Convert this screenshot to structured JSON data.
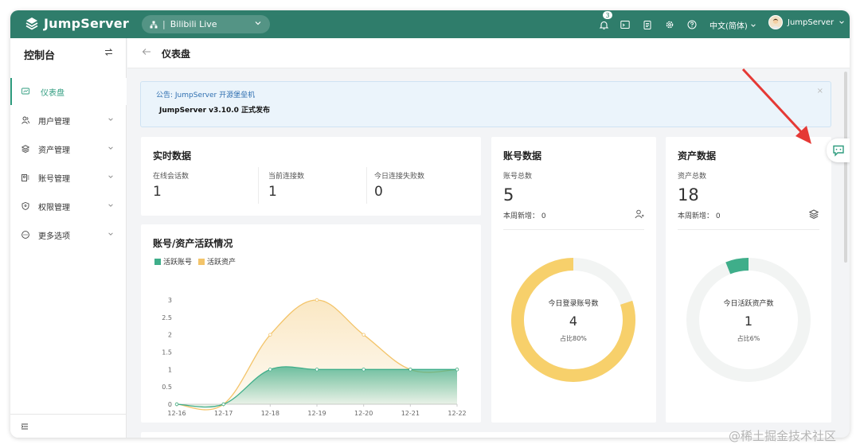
{
  "header": {
    "logo_text": "JumpServer",
    "org_name": "Bilibili Live",
    "notification_count": "3",
    "language": "中文(简体)",
    "username": "JumpServer",
    "brand_color": "#2f7d6b"
  },
  "sidebar": {
    "title": "控制台",
    "items": [
      {
        "label": "仪表盘",
        "icon": "dashboard-icon"
      },
      {
        "label": "用户管理",
        "icon": "users-icon"
      },
      {
        "label": "资产管理",
        "icon": "layers-icon"
      },
      {
        "label": "账号管理",
        "icon": "account-icon"
      },
      {
        "label": "权限管理",
        "icon": "shield-icon"
      },
      {
        "label": "更多选项",
        "icon": "more-icon"
      }
    ]
  },
  "page": {
    "title": "仪表盘"
  },
  "notice": {
    "title": "公告: JumpServer 开源堡垒机",
    "body": "JumpServer v3.10.0 正式发布"
  },
  "realtime": {
    "title": "实时数据",
    "stats": [
      {
        "label": "在线会话数",
        "value": "1"
      },
      {
        "label": "当前连接数",
        "value": "1"
      },
      {
        "label": "今日连接失败数",
        "value": "0"
      }
    ]
  },
  "account_card": {
    "title": "账号数据",
    "total_label": "账号总数",
    "total": "5",
    "week_new": "本周新增： 0",
    "donut_label": "今日登录账号数",
    "donut_value": "4",
    "donut_pct": "占比80%",
    "donut_fraction": 0.8,
    "donut_color": "#f7d06b"
  },
  "asset_card": {
    "title": "资产数据",
    "total_label": "资产总数",
    "total": "18",
    "week_new": "本周新增： 0",
    "donut_label": "今日活跃资产数",
    "donut_value": "1",
    "donut_pct": "占比6%",
    "donut_fraction": 0.06,
    "donut_color": "#3fae8a"
  },
  "activity": {
    "title": "账号/资产活跃情况",
    "legend_accounts": "活跃账号",
    "legend_assets": "活跃资产"
  },
  "chart_data": {
    "type": "area",
    "title": "账号/资产活跃情况",
    "x": [
      "12-16",
      "12-17",
      "12-18",
      "12-19",
      "12-20",
      "12-21",
      "12-22"
    ],
    "series": [
      {
        "name": "活跃账号",
        "values": [
          0,
          0,
          1,
          1,
          1,
          1,
          1
        ],
        "color": "#3fae8a"
      },
      {
        "name": "活跃资产",
        "values": [
          0,
          0,
          2,
          3,
          2,
          1,
          1
        ],
        "color": "#f3c46a"
      }
    ],
    "ylim": [
      0,
      3
    ],
    "yticks": [
      "0",
      "0.5",
      "1",
      "1.5",
      "2",
      "2.5",
      "3"
    ],
    "grid": false,
    "legend": "top-left"
  },
  "watermark": "@稀土掘金技术社区"
}
